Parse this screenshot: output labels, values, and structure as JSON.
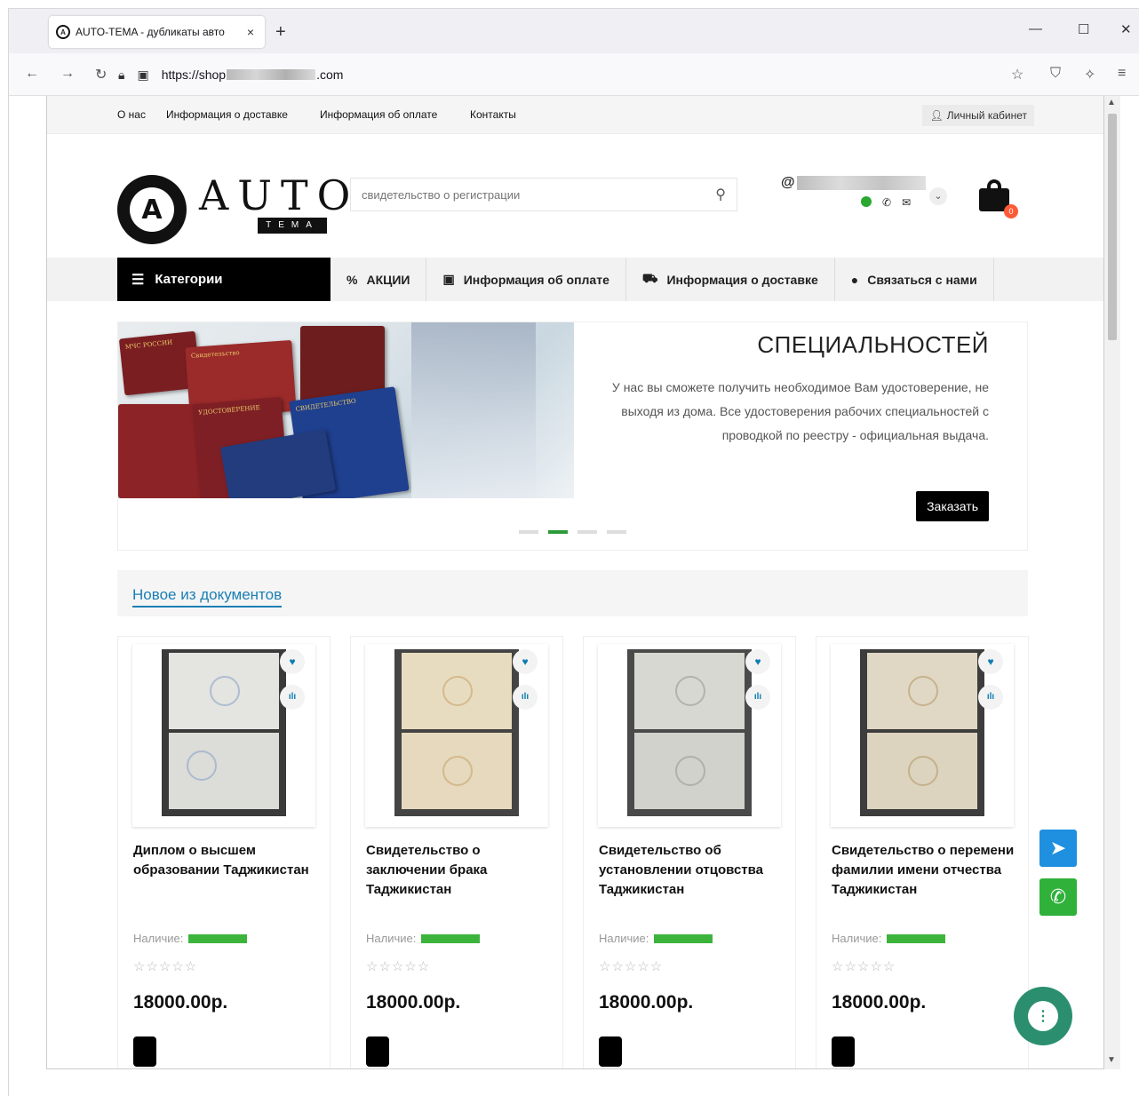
{
  "browser": {
    "tab_title": "AUTO-TEMA - дубликаты авто",
    "tab_close": "×",
    "new_tab": "+",
    "url_prefix": "https://shop",
    "url_suffix": ".com",
    "min": "—",
    "max": "☐",
    "close": "✕"
  },
  "topinfo": {
    "links": [
      "О нас",
      "Информация о доставке",
      "Информация об оплате",
      "Контакты"
    ],
    "cabinet": "Личный кабинет"
  },
  "header": {
    "logo_auto": "AUTO",
    "logo_tema": "TEMA",
    "search_placeholder": "свидетельство о регистрации",
    "email_prefix": "@"
  },
  "cart": {
    "count": "0"
  },
  "menu": {
    "categories": "Категории",
    "items": [
      {
        "icon": "%",
        "label": "АКЦИИ"
      },
      {
        "icon": "▣",
        "label": "Информация об оплате"
      },
      {
        "icon": "⛟",
        "label": "Информация о доставке"
      },
      {
        "icon": "●",
        "label": "Связаться с нами"
      }
    ]
  },
  "slider": {
    "title": "СПЕЦИАЛЬНОСТЕЙ",
    "text": "У нас вы сможете получить необходимое Вам удостоверение, не выходя из дома. Все удостоверения рабочих специальностей с проводкой по реестру - официальная выдача.",
    "button": "Заказать",
    "active_dot": 1,
    "doc_labels": [
      "МЧС РОССИИ",
      "Свидетельство",
      "СВИДЕТЕЛЬСТВО",
      "УДОСТОВЕРЕНИЕ"
    ]
  },
  "section": {
    "title": "Новое из документов"
  },
  "products": [
    {
      "name": "Диплом о высшем образовании Таджикистан",
      "availability": "Наличие:",
      "price": "18000.00р."
    },
    {
      "name": "Свидетельство о заключении брака Таджикистан",
      "availability": "Наличие:",
      "price": "18000.00р."
    },
    {
      "name": "Свидетельство об установлении отцовства Таджикистан",
      "availability": "Наличие:",
      "price": "18000.00р."
    },
    {
      "name": "Свидетельство о перемени фамилии имени отчества Таджикистан",
      "availability": "Наличие:",
      "price": "18000.00р."
    }
  ],
  "colors": {
    "accent": "#1a7fb5",
    "telegram": "#1f8fe0",
    "whatsapp": "#2fb13a",
    "stock": "#3cb43c",
    "badge": "#ff5a36"
  }
}
